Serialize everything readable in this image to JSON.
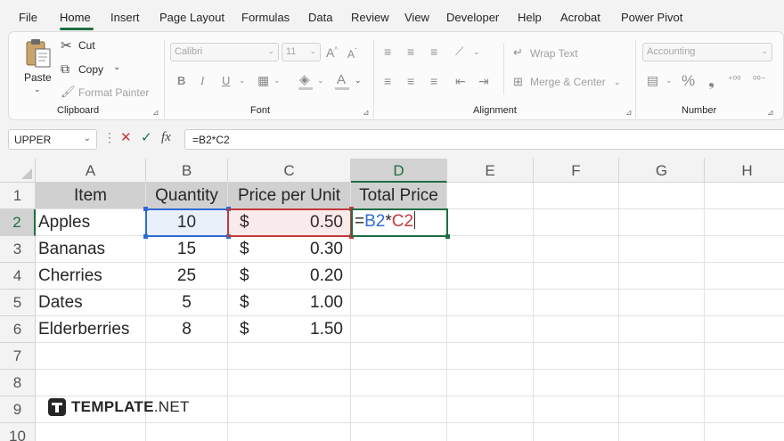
{
  "menu": {
    "tabs": [
      "File",
      "Home",
      "Insert",
      "Page Layout",
      "Formulas",
      "Data",
      "Review",
      "View",
      "Developer",
      "Help",
      "Acrobat",
      "Power Pivot"
    ],
    "active": "Home"
  },
  "ribbon": {
    "clipboard": {
      "label": "Clipboard",
      "paste": "Paste",
      "cut": "Cut",
      "copy": "Copy",
      "format_painter": "Format Painter"
    },
    "font": {
      "label": "Font",
      "font_name": "Calibri",
      "font_size": "11"
    },
    "alignment": {
      "label": "Alignment",
      "wrap_text": "Wrap Text",
      "merge_center": "Merge & Center"
    },
    "number": {
      "label": "Number",
      "format": "Accounting"
    }
  },
  "formula_bar": {
    "name_box": "UPPER",
    "fx": "fx",
    "formula": "=B2*C2"
  },
  "sheet": {
    "columns": [
      "A",
      "B",
      "C",
      "D",
      "E",
      "F",
      "G",
      "H"
    ],
    "rows": [
      "1",
      "2",
      "3",
      "4",
      "5",
      "6",
      "7",
      "8",
      "9",
      "10"
    ],
    "selected_column": "D",
    "selected_row": "2",
    "headers": {
      "item": "Item",
      "quantity": "Quantity",
      "price": "Price per Unit",
      "total": "Total Price"
    },
    "currency_symbol": "$",
    "data": [
      {
        "item": "Apples",
        "quantity": "10",
        "price": "0.50"
      },
      {
        "item": "Bananas",
        "quantity": "15",
        "price": "0.30"
      },
      {
        "item": "Cherries",
        "quantity": "25",
        "price": "0.20"
      },
      {
        "item": "Dates",
        "quantity": "5",
        "price": "1.00"
      },
      {
        "item": "Elderberries",
        "quantity": "8",
        "price": "1.50"
      }
    ],
    "editing": {
      "prefix": "=",
      "ref1": "B2",
      "op": "*",
      "ref2": "C2"
    }
  },
  "watermark": {
    "brand": "TEMPLATE",
    "suffix": ".NET"
  },
  "colors": {
    "accent_green": "#1e6e43",
    "ref_blue": "#2f6bd2",
    "ref_red": "#c33a3a",
    "header_fill": "#d0d0d0"
  }
}
